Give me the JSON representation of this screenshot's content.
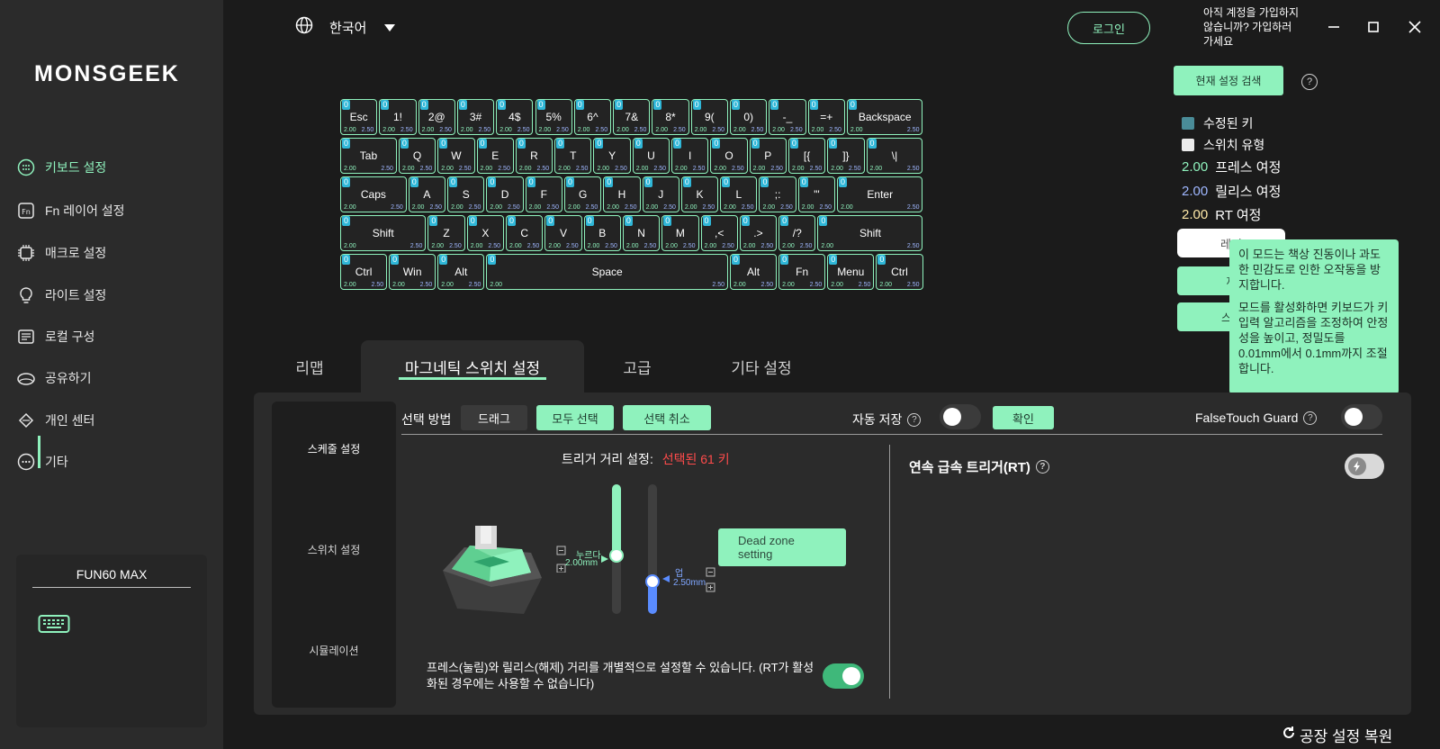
{
  "app": {
    "logo": "MONSGEEK"
  },
  "sidebar": {
    "items": [
      {
        "label": "키보드 설정",
        "icon": "keyboard-dots-icon",
        "active": true
      },
      {
        "label": "Fn 레이어 설정",
        "icon": "fn-icon"
      },
      {
        "label": "매크로 설정",
        "icon": "chip-icon"
      },
      {
        "label": "라이트 설정",
        "icon": "bulb-icon"
      },
      {
        "label": "로컬 구성",
        "icon": "list-icon"
      },
      {
        "label": "공유하기",
        "icon": "share-cloud-icon"
      },
      {
        "label": "개인 센터",
        "icon": "diamond-icon"
      },
      {
        "label": "기타",
        "icon": "more-icon"
      }
    ],
    "device": {
      "name": "FUN60 MAX"
    }
  },
  "topbar": {
    "language": "한국어",
    "login": "로그인",
    "signup": "아직 계정을 가입하지 않습니까? 가입하러 가세요"
  },
  "keyboard": {
    "rows": [
      [
        {
          "k": "Esc"
        },
        {
          "k": "1!"
        },
        {
          "k": "2@"
        },
        {
          "k": "3#"
        },
        {
          "k": "4$"
        },
        {
          "k": "5%"
        },
        {
          "k": "6^"
        },
        {
          "k": "7&"
        },
        {
          "k": "8*"
        },
        {
          "k": "9("
        },
        {
          "k": "0)"
        },
        {
          "k": "-_"
        },
        {
          "k": "=+"
        },
        {
          "k": "Backspace"
        }
      ],
      [
        {
          "k": "Tab"
        },
        {
          "k": "Q"
        },
        {
          "k": "W"
        },
        {
          "k": "E"
        },
        {
          "k": "R"
        },
        {
          "k": "T"
        },
        {
          "k": "Y"
        },
        {
          "k": "U"
        },
        {
          "k": "I"
        },
        {
          "k": "O"
        },
        {
          "k": "P"
        },
        {
          "k": "[{"
        },
        {
          "k": "]}"
        },
        {
          "k": "\\|"
        }
      ],
      [
        {
          "k": "Caps"
        },
        {
          "k": "A"
        },
        {
          "k": "S"
        },
        {
          "k": "D"
        },
        {
          "k": "F"
        },
        {
          "k": "G"
        },
        {
          "k": "H"
        },
        {
          "k": "J"
        },
        {
          "k": "K"
        },
        {
          "k": "L"
        },
        {
          "k": ";:"
        },
        {
          "k": "'\""
        },
        {
          "k": "Enter"
        }
      ],
      [
        {
          "k": "Shift"
        },
        {
          "k": "Z"
        },
        {
          "k": "X"
        },
        {
          "k": "C"
        },
        {
          "k": "V"
        },
        {
          "k": "B"
        },
        {
          "k": "N"
        },
        {
          "k": "M"
        },
        {
          "k": ",<"
        },
        {
          "k": ".>"
        },
        {
          "k": "/?"
        },
        {
          "k": "Shift"
        }
      ],
      [
        {
          "k": "Ctrl"
        },
        {
          "k": "Win"
        },
        {
          "k": "Alt"
        },
        {
          "k": "Space"
        },
        {
          "k": "Alt"
        },
        {
          "k": "Fn"
        },
        {
          "k": "Menu"
        },
        {
          "k": "Ctrl"
        }
      ]
    ],
    "count": "0",
    "press": "2.00",
    "release": "2.50"
  },
  "right_panel": {
    "search_btn": "현재 설정 검색",
    "legend_modified": "수정된 키",
    "legend_switch": "스위치 유형",
    "press_val": "2.00",
    "press_label": "프레스 여정",
    "release_val": "2.00",
    "release_label": "릴리스 여정",
    "rt_val": "2.00",
    "rt_label": "RT 여정",
    "btn1": "레이",
    "btn2": "재",
    "btn3": "스케",
    "colors": {
      "press": "#8ff2bd",
      "release": "#9fb7ff",
      "rt": "#ffe9a8"
    }
  },
  "tooltip": {
    "p1": "이 모드는 책상 진동이나 과도한 민감도로 인한 오작동을 방지합니다.",
    "p2": "모드를 활성화하면 키보드가 키 입력 알고리즘을 조정하여 안정성을 높이고, 정밀도를 0.01mm에서 0.1mm까지 조절합니다."
  },
  "tabs": [
    "리맵",
    "마그네틱 스위치 설정",
    "고급",
    "기타 설정"
  ],
  "subnav": [
    "스케줄 설정",
    "스위치 설정",
    "시뮬레이션"
  ],
  "selection": {
    "label": "선택 방법",
    "drag": "드래그",
    "select_all": "모두 선택",
    "deselect": "선택 취소",
    "autosave": "자동 저장",
    "confirm": "확인",
    "falsetouch": "FalseTouch Guard"
  },
  "trigger": {
    "title": "트리거 거리 설정:",
    "selected": "선택된 61 키",
    "press_label": "누르다",
    "press_value": "2.00mm",
    "release_label": "업",
    "release_value": "2.50mm",
    "deadzone": "Dead zone setting",
    "note": "프레스(눌림)와 릴리스(해제) 거리를 개별적으로 설정할 수 있습니다. (RT가 활성화된 경우에는 사용할 수 없습니다)",
    "press_fraction": 0.55,
    "release_fraction": 0.25
  },
  "rt": {
    "title": "연속 급속 트리거(RT)"
  },
  "footer": {
    "reset": "공장 설정 복원"
  }
}
